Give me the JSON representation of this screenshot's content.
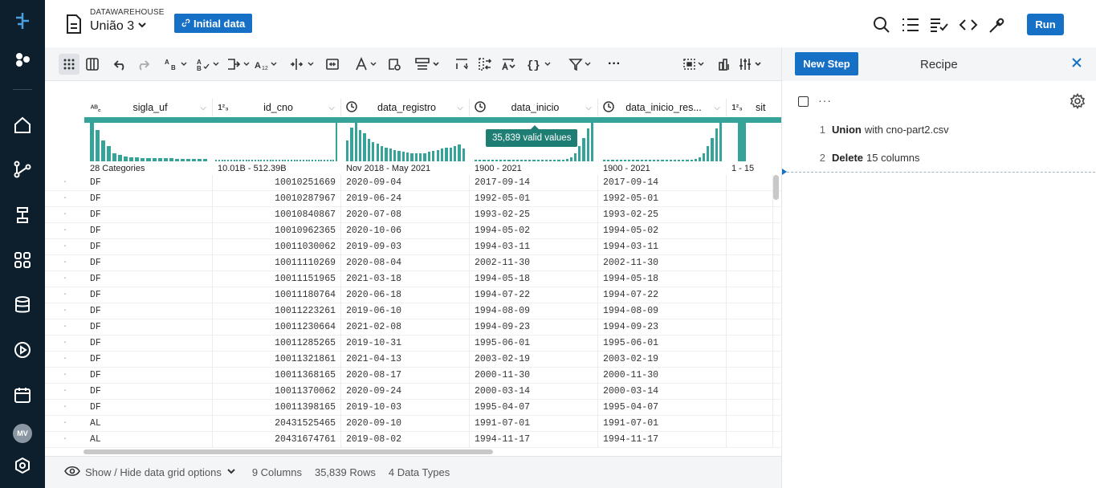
{
  "sidebar": {
    "items": [
      "logo-icon",
      "apps-dots-icon",
      "home-icon",
      "flows-icon",
      "plans-icon",
      "library-icon",
      "database-icon",
      "runs-icon",
      "calendar-icon"
    ],
    "user_initials": "MV"
  },
  "header": {
    "workspace": "DATAWAREHOUSE",
    "dataset": "União 3",
    "badge": "Initial data",
    "run_label": "Run"
  },
  "columns": [
    {
      "name": "sigla_uf",
      "type": "ABC",
      "summary": "28 Categories"
    },
    {
      "name": "id_cno",
      "type": "123",
      "summary": "10.01B - 512.39B"
    },
    {
      "name": "data_registro",
      "type": "clock",
      "summary": "Nov 2018 - May 2021"
    },
    {
      "name": "data_inicio",
      "type": "clock",
      "summary": "1900 - 2021"
    },
    {
      "name": "data_inicio_res...",
      "type": "clock",
      "summary": "1900 - 2021"
    },
    {
      "name": "sit",
      "type": "123",
      "summary": "1 - 15"
    }
  ],
  "tooltip": "35,839 valid values",
  "histograms": [
    [
      55,
      45,
      30,
      22,
      12,
      9,
      7,
      6,
      6,
      5,
      5,
      5,
      5,
      5,
      5,
      4,
      4,
      4,
      4,
      4,
      4
    ],
    [
      5,
      5,
      5,
      5,
      5,
      5,
      5,
      5,
      5,
      5,
      5,
      5,
      5,
      5,
      5,
      5,
      5,
      5,
      5,
      5,
      5,
      5,
      5,
      5,
      5,
      5,
      5,
      5,
      5,
      5,
      5,
      5,
      5,
      5,
      5,
      5,
      5,
      5,
      5,
      5,
      98
    ],
    [
      30,
      48,
      55,
      45,
      40,
      32,
      28,
      25,
      22,
      20,
      18,
      16,
      15,
      14,
      13,
      12,
      11,
      11,
      12,
      14,
      15,
      16,
      18,
      19,
      20,
      22,
      24,
      18
    ],
    [
      2,
      2,
      2,
      2,
      2,
      2,
      2,
      2,
      2,
      2,
      2,
      2,
      2,
      2,
      2,
      2,
      2,
      2,
      2,
      2,
      3,
      4,
      6,
      10,
      20,
      40,
      60,
      85,
      100
    ],
    [
      2,
      2,
      2,
      2,
      2,
      2,
      2,
      2,
      2,
      2,
      2,
      2,
      2,
      2,
      2,
      2,
      2,
      2,
      2,
      2,
      3,
      4,
      6,
      10,
      20,
      40,
      60,
      85,
      100
    ],
    [
      100
    ]
  ],
  "rows": [
    [
      "DF",
      "10010251669",
      "2020-09-04",
      "2017-09-14",
      "2017-09-14"
    ],
    [
      "DF",
      "10010287967",
      "2019-06-24",
      "1992-05-01",
      "1992-05-01"
    ],
    [
      "DF",
      "10010840867",
      "2020-07-08",
      "1993-02-25",
      "1993-02-25"
    ],
    [
      "DF",
      "10010962365",
      "2020-10-06",
      "1994-05-02",
      "1994-05-02"
    ],
    [
      "DF",
      "10011030062",
      "2019-09-03",
      "1994-03-11",
      "1994-03-11"
    ],
    [
      "DF",
      "10011110269",
      "2020-08-04",
      "2002-11-30",
      "2002-11-30"
    ],
    [
      "DF",
      "10011151965",
      "2021-03-18",
      "1994-05-18",
      "1994-05-18"
    ],
    [
      "DF",
      "10011180764",
      "2020-06-18",
      "1994-07-22",
      "1994-07-22"
    ],
    [
      "DF",
      "10011223261",
      "2019-06-10",
      "1994-08-09",
      "1994-08-09"
    ],
    [
      "DF",
      "10011230664",
      "2021-02-08",
      "1994-09-23",
      "1994-09-23"
    ],
    [
      "DF",
      "10011285265",
      "2019-10-31",
      "1995-06-01",
      "1995-06-01"
    ],
    [
      "DF",
      "10011321861",
      "2021-04-13",
      "2003-02-19",
      "2003-02-19"
    ],
    [
      "DF",
      "10011368165",
      "2020-08-17",
      "2000-11-30",
      "2000-11-30"
    ],
    [
      "DF",
      "10011370062",
      "2020-09-24",
      "2000-03-14",
      "2000-03-14"
    ],
    [
      "DF",
      "10011398165",
      "2019-10-03",
      "1995-04-07",
      "1995-04-07"
    ],
    [
      "AL",
      "20431525465",
      "2020-09-10",
      "1991-07-01",
      "1991-07-01"
    ],
    [
      "AL",
      "20431674761",
      "2019-08-02",
      "1994-11-17",
      "1994-11-17"
    ]
  ],
  "footer": {
    "options_label": "Show / Hide data grid options",
    "columns": "9 Columns",
    "rows": "35,839 Rows",
    "types": "4 Data Types"
  },
  "recipe": {
    "new_step_label": "New Step",
    "title": "Recipe",
    "menu": "···",
    "steps": [
      {
        "num": "1",
        "verb": "Union",
        "rest": "with cno-part2.csv"
      },
      {
        "num": "2",
        "verb": "Delete",
        "rest": "15 columns"
      }
    ]
  },
  "colors": {
    "accent": "#1671c6",
    "teal": "#36a398",
    "sidebar": "#0d1e2d"
  }
}
